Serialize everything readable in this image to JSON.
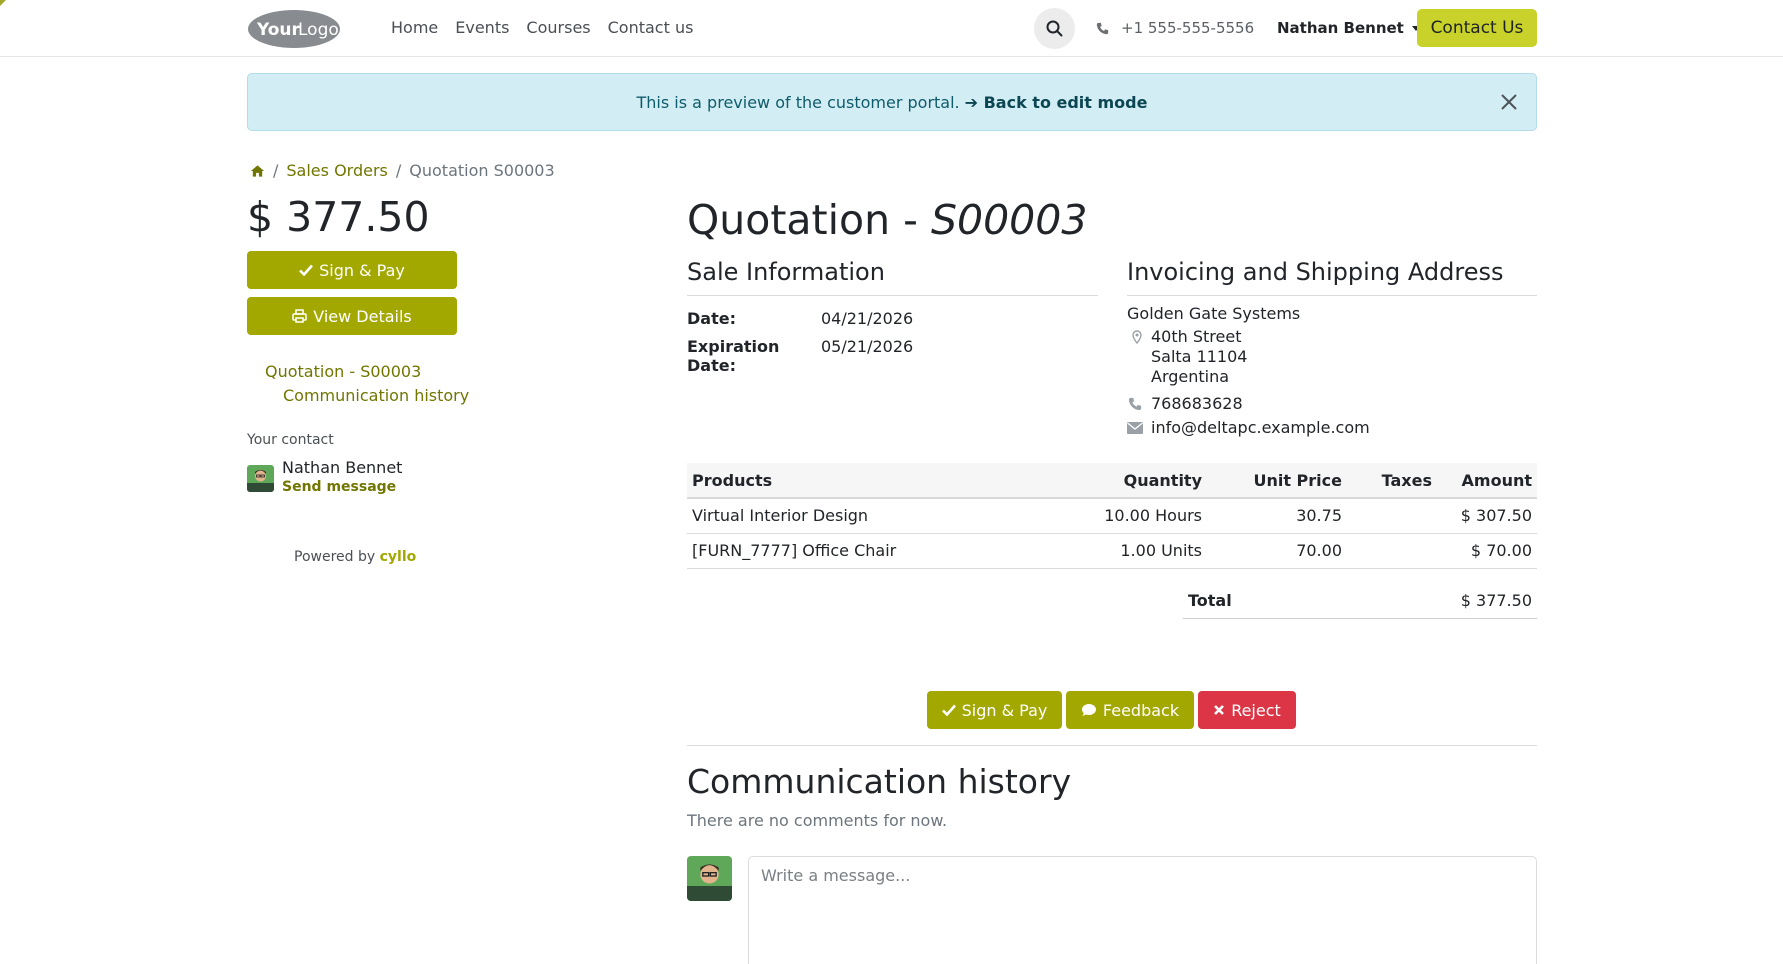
{
  "header": {
    "logo_text": "YourLogo",
    "nav": [
      "Home",
      "Events",
      "Courses",
      "Contact us"
    ],
    "phone": "+1 555-555-5556",
    "user_name": "Nathan Bennet",
    "contact_button": "Contact Us"
  },
  "alert": {
    "message": "This is a preview of the customer portal.",
    "link": "➔ Back to edit mode"
  },
  "breadcrumb": {
    "parent": "Sales Orders",
    "current": "Quotation S00003"
  },
  "sidebar": {
    "amount": "$ 377.50",
    "sign_pay": "Sign & Pay",
    "view_details": "View Details",
    "links": [
      "Quotation - S00003",
      "Communication history"
    ],
    "contact_label": "Your contact",
    "contact_name": "Nathan Bennet",
    "send_message": "Send message",
    "powered_by": "Powered by",
    "powered_brand": "cyllo"
  },
  "main": {
    "title_prefix": "Quotation - ",
    "title_ref": "S00003",
    "sale_info_heading": "Sale Information",
    "address_heading": "Invoicing and Shipping Address",
    "date_label": "Date:",
    "date_value": "04/21/2026",
    "expiration_label": "Expiration Date:",
    "expiration_value": "05/21/2026",
    "address": {
      "company": "Golden Gate Systems",
      "street": "40th Street",
      "city": "Salta 11104",
      "country": "Argentina",
      "phone": "768683628",
      "email": "info@deltapc.example.com"
    }
  },
  "table": {
    "headers": [
      "Products",
      "Quantity",
      "Unit Price",
      "Taxes",
      "Amount"
    ],
    "rows": [
      {
        "product": "Virtual Interior Design",
        "quantity": "10.00 Hours",
        "unit_price": "30.75",
        "taxes": "",
        "amount": "$ 307.50"
      },
      {
        "product": "[FURN_7777] Office Chair",
        "quantity": "1.00 Units",
        "unit_price": "70.00",
        "taxes": "",
        "amount": "$ 70.00"
      }
    ],
    "total_label": "Total",
    "total_value": "$ 377.50"
  },
  "actions": {
    "sign_pay": "Sign & Pay",
    "feedback": "Feedback",
    "reject": "Reject"
  },
  "communication": {
    "heading": "Communication history",
    "empty": "There are no comments for now.",
    "placeholder": "Write a message..."
  },
  "colors": {
    "accent": "#a2a800",
    "contact_button": "#c9d22a",
    "reject": "#dc3545",
    "alert_bg": "#d2eef4"
  }
}
